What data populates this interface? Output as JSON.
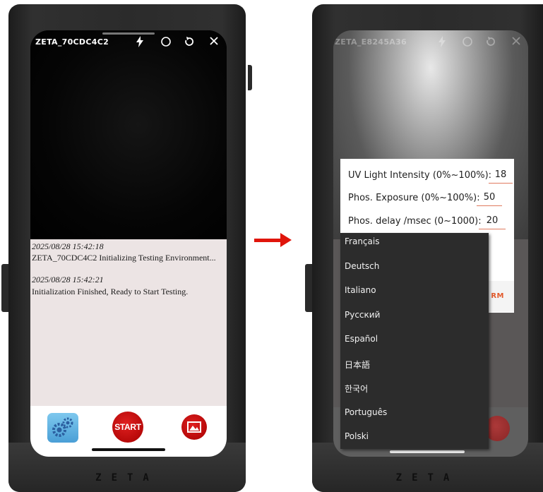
{
  "left_screen": {
    "device_name": "ZETA_70CDC4C2",
    "toolbar_icons": [
      "flash-icon",
      "circle-icon",
      "refresh-icon",
      "close-icon"
    ],
    "log": [
      {
        "timestamp": "2025/08/28 15:42:18",
        "message": "ZETA_70CDC4C2 Initializing Testing Environment..."
      },
      {
        "timestamp": "2025/08/28 15:42:21",
        "message": "Initialization Finished, Ready to Start Testing."
      }
    ],
    "bottom": {
      "start_label": "START"
    }
  },
  "right_screen": {
    "device_name": "ZETA_E8245A36",
    "settings": [
      {
        "label": "UV Light Intensity (0%~100%):",
        "value": "18"
      },
      {
        "label": "Phos. Exposure (0%~100%):",
        "value": "50"
      },
      {
        "label": "Phos. delay /msec (0~1000):",
        "value": "20"
      }
    ],
    "confirm_label": "RM",
    "languages": [
      "Français",
      "Deutsch",
      "Italiano",
      "Русский",
      "Español",
      "日本語",
      "한국어",
      "Português",
      "Polski"
    ]
  },
  "brand": "ZETA",
  "colors": {
    "accent_red": "#e0150b",
    "confirm_orange": "#e25a2c"
  }
}
